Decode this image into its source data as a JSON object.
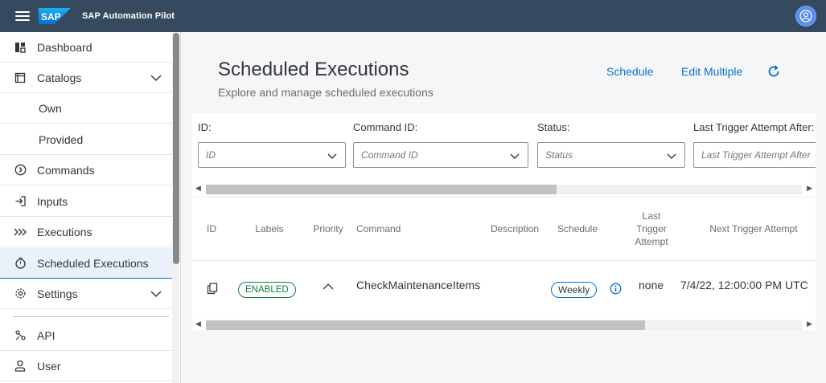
{
  "shell": {
    "app_title": "SAP Automation Pilot",
    "logo_text": "SAP",
    "brand_color": "#354a5f",
    "accent": "#0a6ed1"
  },
  "sidebar": {
    "items": [
      {
        "label": "Dashboard",
        "icon": "dashboard-icon"
      },
      {
        "label": "Catalogs",
        "icon": "catalog-icon"
      },
      {
        "label": "Own"
      },
      {
        "label": "Provided"
      },
      {
        "label": "Commands",
        "icon": "command-icon"
      },
      {
        "label": "Inputs",
        "icon": "input-icon"
      },
      {
        "label": "Executions",
        "icon": "executions-icon"
      },
      {
        "label": "Scheduled Executions",
        "icon": "timer-icon",
        "selected": true
      },
      {
        "label": "Settings",
        "icon": "settings-icon"
      },
      {
        "label": "API",
        "icon": "api-icon"
      },
      {
        "label": "User",
        "icon": "user-icon"
      }
    ]
  },
  "main": {
    "title": "Scheduled Executions",
    "subtitle": "Explore and manage scheduled executions",
    "actions": {
      "schedule": "Schedule",
      "edit_multiple": "Edit Multiple"
    },
    "filters": [
      {
        "label": "ID:",
        "placeholder": "ID"
      },
      {
        "label": "Command ID:",
        "placeholder": "Command ID"
      },
      {
        "label": "Status:",
        "placeholder": "Status"
      },
      {
        "label": "Last Trigger Attempt After:",
        "placeholder": "Last Trigger Attempt After"
      }
    ],
    "table": {
      "columns": [
        "ID",
        "Labels",
        "Priority",
        "Command",
        "Description",
        "Schedule",
        "Last Trigger Attempt",
        "Next Trigger Attempt"
      ],
      "rows": [
        {
          "labels": "ENABLED",
          "command": "CheckMaintenanceItems",
          "description": "",
          "schedule": "Weekly",
          "last_trigger": "none",
          "next_trigger": "7/4/22, 12:00:00 PM UTC"
        }
      ]
    }
  }
}
